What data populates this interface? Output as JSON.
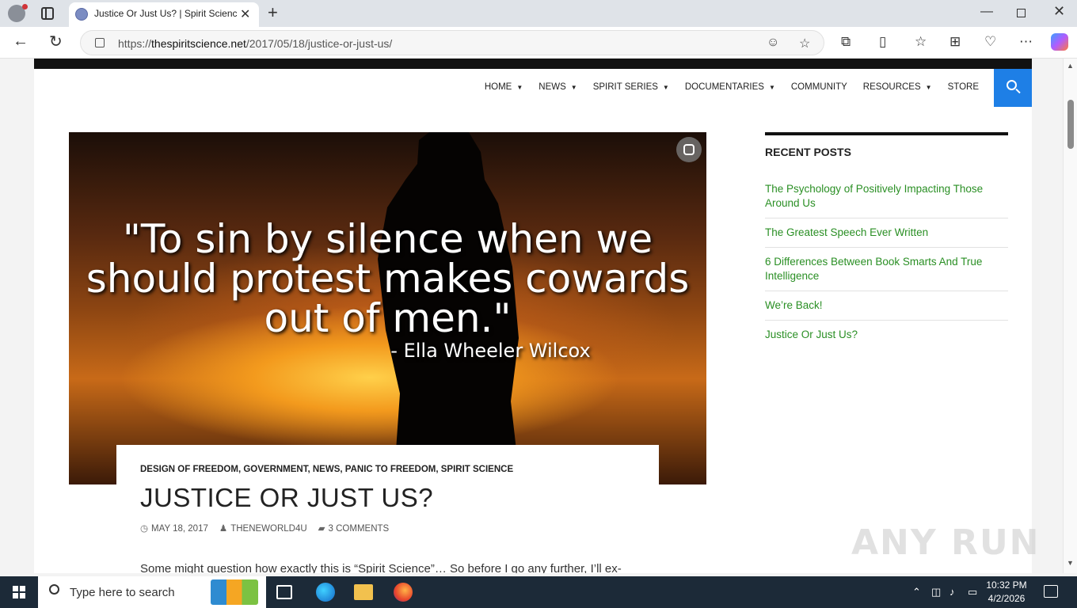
{
  "browser": {
    "tab_title": "Justice Or Just Us? | Spirit Science",
    "url_host": "thespiritscience.net",
    "url_prefix": "https://",
    "url_path": "/2017/05/18/justice-or-just-us/",
    "icons": [
      "profile-icon",
      "tabs-icon",
      "back-icon",
      "reload-icon",
      "lock-icon",
      "reader-icon",
      "favorite-icon",
      "extensions-icon",
      "split-screen-icon",
      "favorites-icon",
      "collections-icon",
      "performance-icon",
      "more-icon",
      "copilot-icon"
    ]
  },
  "nav": {
    "items": [
      {
        "label": "HOME",
        "dropdown": true
      },
      {
        "label": "NEWS",
        "dropdown": true
      },
      {
        "label": "SPIRIT SERIES",
        "dropdown": true
      },
      {
        "label": "DOCUMENTARIES",
        "dropdown": true
      },
      {
        "label": "COMMUNITY",
        "dropdown": false
      },
      {
        "label": "RESOURCES",
        "dropdown": true
      },
      {
        "label": "STORE",
        "dropdown": false
      }
    ],
    "search_color": "#1e7fe6"
  },
  "hero": {
    "quote_line1": "\"To sin by silence when we",
    "quote_line2": "should protest makes cowards",
    "quote_line3": "out of men.\"",
    "quote_author": "- Ella Wheeler Wilcox"
  },
  "entry": {
    "categories": "DESIGN OF FREEDOM, GOVERNMENT, NEWS, PANIC TO FREEDOM, SPIRIT SCIENCE",
    "title": "JUSTICE OR JUST US?",
    "date": "MAY 18, 2017",
    "author": "THENEWORLD4U",
    "comments": "3 COMMENTS",
    "excerpt": "Some might question how exactly this is “Spirit Science”… So before I go any further, I’ll ex-"
  },
  "sidebar": {
    "widget_title": "RECENT POSTS",
    "link_color": "#2a8f24",
    "posts": [
      "The Psychology of Positively Impacting Those Around Us",
      "The Greatest Speech Ever Written",
      "6 Differences Between Book Smarts And True Intelligence",
      "We’re Back!",
      "Justice Or Just Us?"
    ]
  },
  "watermark": "ANY RUN",
  "taskbar": {
    "search_placeholder": "Type here to search",
    "time": "10:32 PM",
    "date": "4/2/2026"
  }
}
